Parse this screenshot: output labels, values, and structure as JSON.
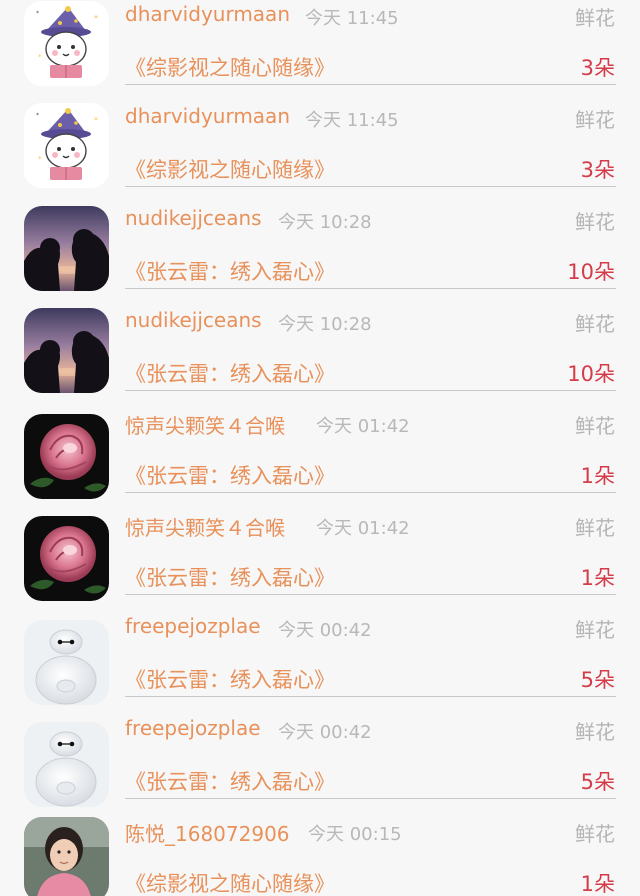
{
  "records": [
    {
      "avatar": "wizard-avatar",
      "username": "dharvidyurmaan",
      "time": "今天 11:45",
      "gift": "鲜花",
      "title": "《综影视之随心随缘》",
      "count": "3朵"
    },
    {
      "avatar": "wizard-avatar",
      "username": "dharvidyurmaan",
      "time": "今天 11:45",
      "gift": "鲜花",
      "title": "《综影视之随心随缘》",
      "count": "3朵"
    },
    {
      "avatar": "couple-silhouette-avatar",
      "username": "nudikejjceans",
      "time": "今天 10:28",
      "gift": "鲜花",
      "title": "《张云雷：绣入磊心》",
      "count": "10朵"
    },
    {
      "avatar": "couple-silhouette-avatar",
      "username": "nudikejjceans",
      "time": "今天 10:28",
      "gift": "鲜花",
      "title": "《张云雷：绣入磊心》",
      "count": "10朵"
    },
    {
      "avatar": "rose-avatar",
      "username": "惊声尖颗笑４合喉",
      "time": "今天 01:42",
      "gift": "鲜花",
      "title": "《张云雷：绣入磊心》",
      "count": "1朵"
    },
    {
      "avatar": "rose-avatar",
      "username": "惊声尖颗笑４合喉",
      "time": "今天 01:42",
      "gift": "鲜花",
      "title": "《张云雷：绣入磊心》",
      "count": "1朵"
    },
    {
      "avatar": "white-robot-avatar",
      "username": "freepejozplae",
      "time": "今天 00:42",
      "gift": "鲜花",
      "title": "《张云雷：绣入磊心》",
      "count": "5朵"
    },
    {
      "avatar": "white-robot-avatar",
      "username": "freepejozplae",
      "time": "今天 00:42",
      "gift": "鲜花",
      "title": "《张云雷：绣入磊心》",
      "count": "5朵"
    },
    {
      "avatar": "photo-avatar",
      "username": "陈悦_168072906",
      "time": "今天 00:15",
      "gift": "鲜花",
      "title": "《综影视之随心随缘》",
      "count": "1朵"
    }
  ],
  "colors": {
    "background": "#f7f7f7",
    "username": "#e8915a",
    "title": "#e8915a",
    "time": "#b8b8b8",
    "gift": "#b5b5b5",
    "count": "#d43c4a",
    "divider": "#c9c9c9"
  }
}
